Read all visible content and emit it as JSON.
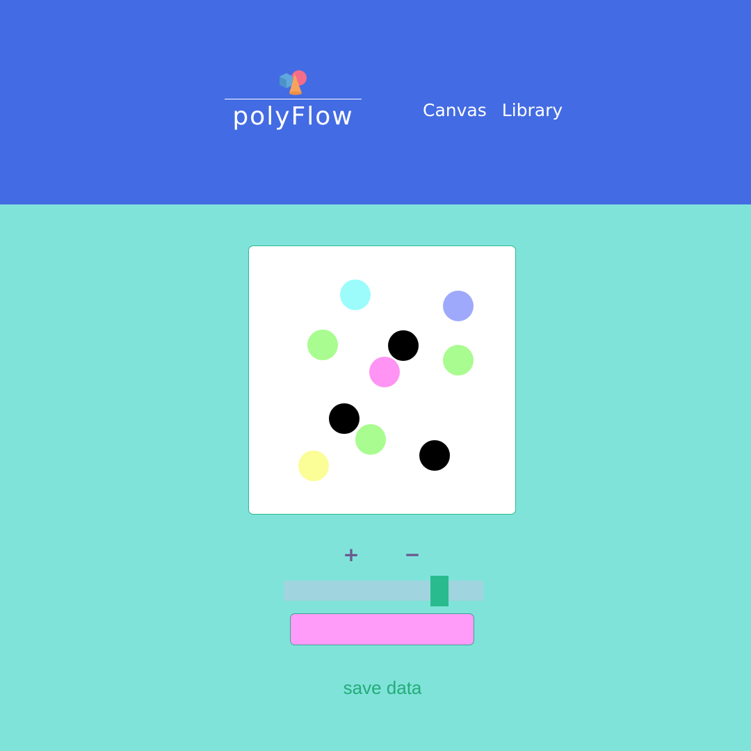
{
  "header": {
    "brand": "polyFlow",
    "nav": [
      {
        "label": "Canvas"
      },
      {
        "label": "Library"
      }
    ]
  },
  "colors": {
    "header_bg": "#436be3",
    "page_bg": "#80e3da",
    "accent": "#29bb8d",
    "swatch": "#ff9bf9"
  },
  "canvas": {
    "dot_colors": [
      "#9cfcfc",
      "#9fa9fb",
      "#a9fc8f",
      "#000000",
      "#a9fc8f",
      "#ff94f4",
      "#000000",
      "#a9fc8f",
      "#000000",
      "#fbfd96"
    ]
  },
  "controls": {
    "plus": "+",
    "minus": "−",
    "slider_fraction": 0.81,
    "save_label": "save data"
  }
}
